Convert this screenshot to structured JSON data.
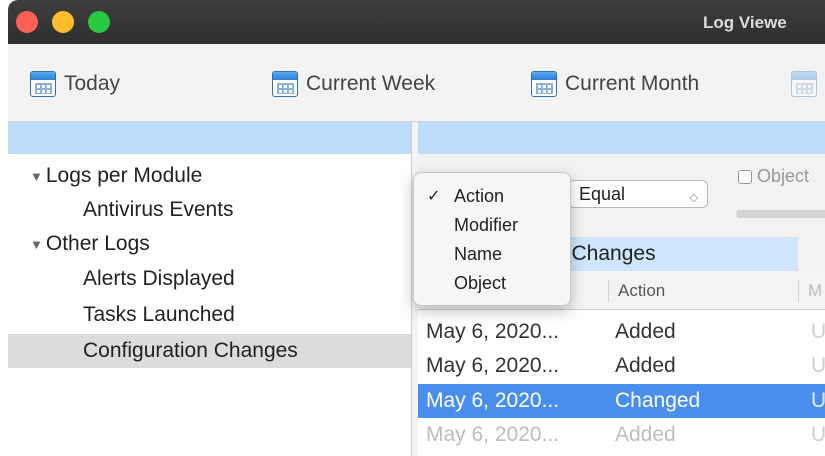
{
  "window": {
    "title": "Log Viewe"
  },
  "toolbar": {
    "buttons": [
      {
        "label": "Today",
        "icon": "calendar-icon"
      },
      {
        "label": "Current Week",
        "icon": "calendar-icon"
      },
      {
        "label": "Current Month",
        "icon": "calendar-icon"
      },
      {
        "label": "",
        "icon": "calendar-icon"
      }
    ]
  },
  "sidebar": {
    "groups": [
      {
        "label": "Logs per Module",
        "children": [
          "Antivirus Events"
        ]
      },
      {
        "label": "Other Logs",
        "children": [
          "Alerts Displayed",
          "Tasks Launched",
          "Configuration Changes"
        ]
      }
    ],
    "selected": "Configuration Changes"
  },
  "filter": {
    "condition": "Equal",
    "checkbox_label": "Object"
  },
  "section": {
    "title": "n Changes"
  },
  "table": {
    "columns": [
      "Action",
      "M"
    ],
    "rows": [
      {
        "date": "May 6, 2020...",
        "action": "Added",
        "modifier": "U"
      },
      {
        "date": "May 6, 2020...",
        "action": "Added",
        "modifier": "U"
      },
      {
        "date": "May 6, 2020...",
        "action": "Changed",
        "modifier": "U"
      },
      {
        "date": "May 6, 2020...",
        "action": "Added",
        "modifier": "U"
      }
    ]
  },
  "popup_menu": {
    "items": [
      "Action",
      "Modifier",
      "Name",
      "Object"
    ],
    "checked": "Action"
  },
  "colors": {
    "selection_blue": "#4a8eec",
    "header_blue": "#bfdcfb",
    "traffic_red": "#fe5f57",
    "traffic_yellow": "#febc2e",
    "traffic_green": "#28c840"
  }
}
